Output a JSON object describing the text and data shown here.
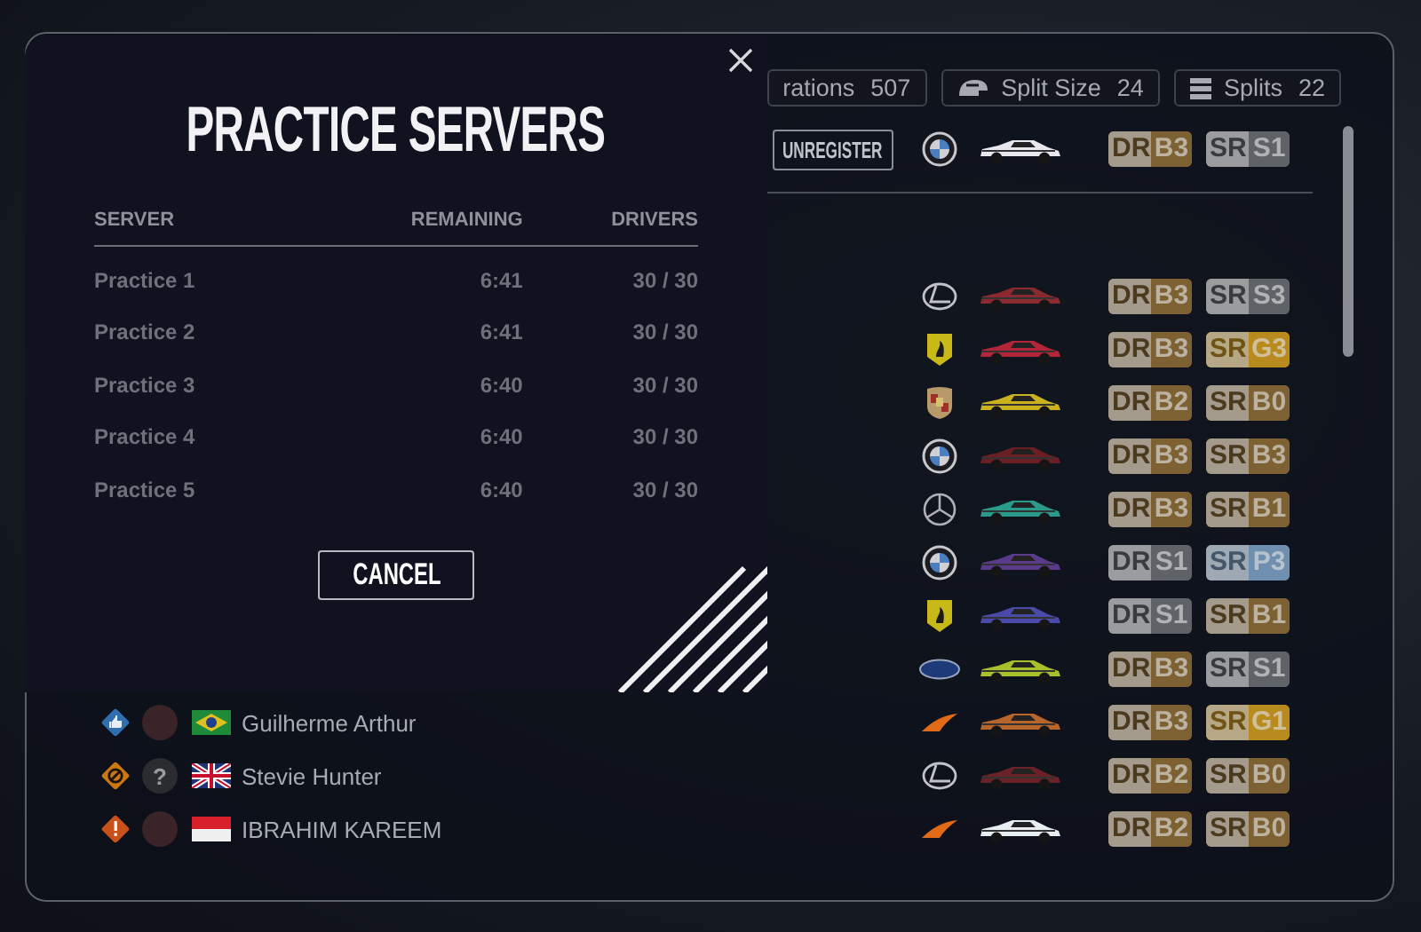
{
  "stats": [
    {
      "label": "rations",
      "value": "507"
    },
    {
      "kind": "helmet",
      "label": "Split Size",
      "value": "24"
    },
    {
      "kind": "stack",
      "label": "Splits",
      "value": "22"
    }
  ],
  "entry": {
    "button": "UNREGISTER",
    "emblem": {
      "kind": "roundel"
    },
    "car": {
      "color": "#e8e8ee"
    },
    "dr": {
      "label": "DR",
      "value": "B3",
      "color": "#7d6132"
    },
    "sr": {
      "label": "SR",
      "value": "S1",
      "color": "#5f6368"
    }
  },
  "rows": [
    {
      "emblem": {
        "kind": "ring-l"
      },
      "car": {
        "color": "#8a2a30"
      },
      "dr": {
        "label": "DR",
        "value": "B3",
        "color": "#7d6132"
      },
      "sr": {
        "label": "SR",
        "value": "S3",
        "color": "#5f6368"
      }
    },
    {
      "emblem": {
        "kind": "shield"
      },
      "car": {
        "color": "#b3263a"
      },
      "dr": {
        "label": "DR",
        "value": "B3",
        "color": "#7d6132"
      },
      "sr": {
        "label": "SR",
        "value": "G3",
        "color": "#b98a1e"
      }
    },
    {
      "emblem": {
        "kind": "crest"
      },
      "car": {
        "color": "#c9b21e"
      },
      "dr": {
        "label": "DR",
        "value": "B2",
        "color": "#7d6132"
      },
      "sr": {
        "label": "SR",
        "value": "B0",
        "color": "#7d6132"
      }
    },
    {
      "emblem": {
        "kind": "roundel"
      },
      "car": {
        "color": "#6a1f24"
      },
      "dr": {
        "label": "DR",
        "value": "B3",
        "color": "#7d6132"
      },
      "sr": {
        "label": "SR",
        "value": "B3",
        "color": "#7d6132"
      }
    },
    {
      "emblem": {
        "kind": "star"
      },
      "car": {
        "color": "#2a9a8a"
      },
      "dr": {
        "label": "DR",
        "value": "B3",
        "color": "#7d6132"
      },
      "sr": {
        "label": "SR",
        "value": "B1",
        "color": "#7d6132"
      }
    },
    {
      "emblem": {
        "kind": "roundel"
      },
      "car": {
        "color": "#5a3a8a"
      },
      "dr": {
        "label": "DR",
        "value": "S1",
        "color": "#5f6368"
      },
      "sr": {
        "label": "SR",
        "value": "P3",
        "color": "#6f8fb0"
      }
    },
    {
      "emblem": {
        "kind": "shield"
      },
      "car": {
        "color": "#4a4aa8"
      },
      "dr": {
        "label": "DR",
        "value": "S1",
        "color": "#5f6368"
      },
      "sr": {
        "label": "SR",
        "value": "B1",
        "color": "#7d6132"
      }
    },
    {
      "emblem": {
        "kind": "oval"
      },
      "car": {
        "color": "#a8c02a"
      },
      "dr": {
        "label": "DR",
        "value": "B3",
        "color": "#7d6132"
      },
      "sr": {
        "label": "SR",
        "value": "S1",
        "color": "#5f6368"
      }
    },
    {
      "status": {
        "kind": "thumb",
        "color": "#2f6fb0"
      },
      "avatar": {
        "kind": "photo"
      },
      "flag": {
        "kind": "brazil"
      },
      "name": "Guilherme Arthur",
      "emblem": {
        "kind": "swoosh"
      },
      "car": {
        "color": "#b8652a"
      },
      "dr": {
        "label": "DR",
        "value": "B3",
        "color": "#7d6132"
      },
      "sr": {
        "label": "SR",
        "value": "G1",
        "color": "#b98a1e"
      }
    },
    {
      "status": {
        "kind": "ban",
        "color": "#c7780f"
      },
      "avatar": {
        "kind": "placeholder",
        "text": "?"
      },
      "flag": {
        "kind": "uk"
      },
      "name": "Stevie Hunter",
      "emblem": {
        "kind": "ring-l"
      },
      "car": {
        "color": "#6a2228"
      },
      "dr": {
        "label": "DR",
        "value": "B2",
        "color": "#7d6132"
      },
      "sr": {
        "label": "SR",
        "value": "B0",
        "color": "#7d6132"
      }
    },
    {
      "status": {
        "kind": "alert",
        "color": "#c8501a"
      },
      "avatar": {
        "kind": "photo"
      },
      "flag": {
        "kind": "indonesia"
      },
      "name": "IBRAHIM KAREEM",
      "emblem": {
        "kind": "swoosh"
      },
      "car": {
        "color": "#e6eef0"
      },
      "dr": {
        "label": "DR",
        "value": "B2",
        "color": "#7d6132"
      },
      "sr": {
        "label": "SR",
        "value": "B0",
        "color": "#7d6132"
      }
    }
  ],
  "modal": {
    "title": "PRACTICE SERVERS",
    "columns": [
      "SERVER",
      "REMAINING",
      "DRIVERS"
    ],
    "servers": [
      {
        "name": "Practice 1",
        "remaining": "6:41",
        "drivers": "30 / 30"
      },
      {
        "name": "Practice 2",
        "remaining": "6:41",
        "drivers": "30 / 30"
      },
      {
        "name": "Practice 3",
        "remaining": "6:40",
        "drivers": "30 / 30"
      },
      {
        "name": "Practice 4",
        "remaining": "6:40",
        "drivers": "30 / 30"
      },
      {
        "name": "Practice 5",
        "remaining": "6:40",
        "drivers": "30 / 30"
      }
    ],
    "cancel": "CANCEL"
  }
}
